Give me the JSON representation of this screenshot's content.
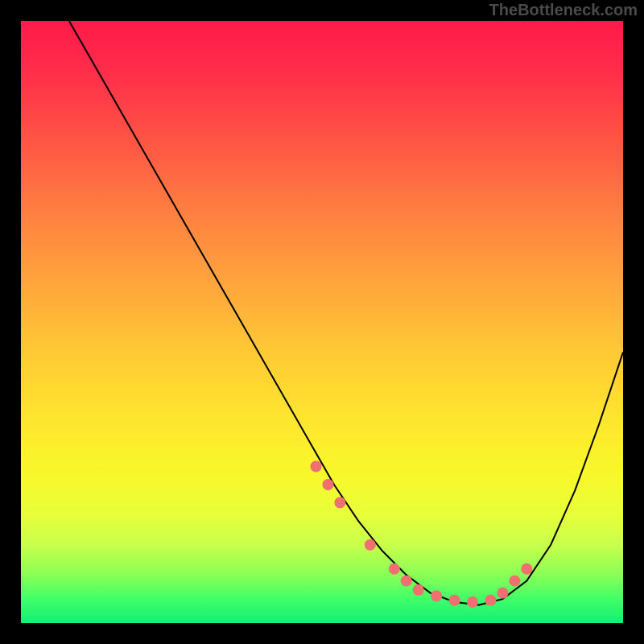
{
  "watermark": "TheBottleneck.com",
  "chart_data": {
    "type": "line",
    "title": "",
    "xlabel": "",
    "ylabel": "",
    "xlim": [
      0,
      100
    ],
    "ylim": [
      0,
      100
    ],
    "curve": {
      "x": [
        8,
        12,
        16,
        20,
        24,
        28,
        32,
        36,
        40,
        44,
        48,
        52,
        56,
        60,
        64,
        68,
        72,
        76,
        80,
        84,
        88,
        92,
        96,
        100
      ],
      "y": [
        100,
        93,
        86,
        79,
        72,
        65,
        58,
        51,
        44,
        37,
        30,
        23,
        17,
        12,
        8,
        5,
        3.5,
        3,
        4,
        7,
        13,
        22,
        33,
        45
      ]
    },
    "markers": {
      "x": [
        49,
        51,
        53,
        58,
        62,
        64,
        66,
        69,
        72,
        75,
        78,
        80,
        82,
        84
      ],
      "y": [
        26,
        23,
        20,
        13,
        9,
        7,
        5.5,
        4.5,
        3.8,
        3.5,
        3.8,
        5,
        7,
        9
      ]
    },
    "marker_color": "#f07070",
    "curve_color": "#000000"
  }
}
